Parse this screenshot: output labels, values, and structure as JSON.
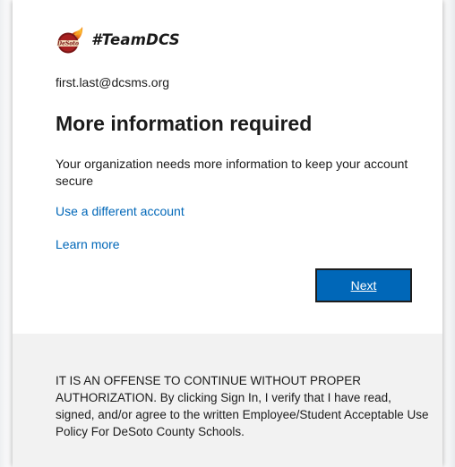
{
  "brand": {
    "name": "#TeamDCS",
    "logo_icon": "desoto-county-schools-logo-icon",
    "logo_text": "DeSoto"
  },
  "account": {
    "email": "first.last@dcsms.org"
  },
  "main": {
    "title": "More information required",
    "description": "Your organization needs more information to keep your account secure",
    "use_different_account": "Use a different account",
    "learn_more": "Learn more",
    "next_label": "Next"
  },
  "footer": {
    "notice": "IT IS AN OFFENSE TO CONTINUE WITHOUT PROPER AUTHORIZATION. By clicking Sign In, I verify that I have read, signed, and/or agree to the written Employee/Student Acceptable Use Policy For DeSoto County Schools."
  },
  "colors": {
    "link": "#0067b8",
    "button_bg": "#0067b8",
    "footer_bg": "#f2f2f2",
    "text": "#1b1b1b"
  }
}
